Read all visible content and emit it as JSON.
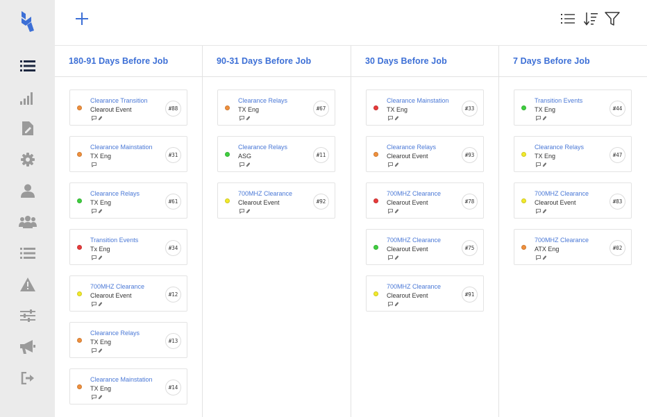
{
  "sidebar": {
    "items": [
      {
        "name": "list-icon",
        "active": true
      },
      {
        "name": "bar-chart-icon"
      },
      {
        "name": "document-edit-icon"
      },
      {
        "name": "gear-icon"
      },
      {
        "name": "user-icon"
      },
      {
        "name": "users-group-icon"
      },
      {
        "name": "list-view-icon"
      },
      {
        "name": "warning-icon"
      },
      {
        "name": "sliders-icon"
      },
      {
        "name": "megaphone-icon"
      },
      {
        "name": "sign-out-icon"
      }
    ]
  },
  "colors": {
    "accent": "#3c6fd6",
    "orange": "#f0903c",
    "red": "#e83b3b",
    "green": "#3fcf3f",
    "yellow": "#f2ea2a"
  },
  "board": {
    "columns": [
      {
        "title": "180-91 Days Before Job",
        "cards": [
          {
            "title": "Clearance Transition",
            "subtitle": "Clearout Event",
            "badge": "#88",
            "status": "orange",
            "attach": true
          },
          {
            "title": "Clearance Mainstation",
            "subtitle": "TX Eng",
            "badge": "#31",
            "status": "orange",
            "attach": false
          },
          {
            "title": "Clearance Relays",
            "subtitle": "TX Eng",
            "badge": "#61",
            "status": "green",
            "attach": true
          },
          {
            "title": "Transition Events",
            "subtitle": "Tx Eng",
            "badge": "#34",
            "status": "red",
            "attach": true
          },
          {
            "title": "700MHZ Clearance",
            "subtitle": "Clearout Event",
            "badge": "#12",
            "status": "yellow",
            "attach": true
          },
          {
            "title": "Clearance Relays",
            "subtitle": "TX Eng",
            "badge": "#13",
            "status": "orange",
            "attach": true
          },
          {
            "title": "Clearance Mainstation",
            "subtitle": "TX Eng",
            "badge": "#14",
            "status": "orange",
            "attach": true
          }
        ]
      },
      {
        "title": "90-31 Days Before Job",
        "cards": [
          {
            "title": "Clearance Relays",
            "subtitle": "TX Eng",
            "badge": "#67",
            "status": "orange",
            "attach": true
          },
          {
            "title": "Clearance Relays",
            "subtitle": "ASG",
            "badge": "#11",
            "status": "green",
            "attach": true
          },
          {
            "title": "700MHZ Clearance",
            "subtitle": "Clearout Event",
            "badge": "#92",
            "status": "yellow",
            "attach": true
          }
        ]
      },
      {
        "title": "30 Days Before Job",
        "cards": [
          {
            "title": "Clearance Mainstation",
            "subtitle": "TX Eng",
            "badge": "#33",
            "status": "red",
            "attach": true
          },
          {
            "title": "Clearance Relays",
            "subtitle": "Clearout Event",
            "badge": "#93",
            "status": "orange",
            "attach": true
          },
          {
            "title": "700MHZ Clearance",
            "subtitle": "Clearout Event",
            "badge": "#78",
            "status": "red",
            "attach": true
          },
          {
            "title": "700MHZ Clearance",
            "subtitle": "Clearout Event",
            "badge": "#75",
            "status": "green",
            "attach": true
          },
          {
            "title": "700MHZ Clearance",
            "subtitle": "Clearout Event",
            "badge": "#91",
            "status": "yellow",
            "attach": true
          }
        ]
      },
      {
        "title": "7 Days Before Job",
        "cards": [
          {
            "title": "Transition Events",
            "subtitle": "TX Eng",
            "badge": "#44",
            "status": "green",
            "attach": true
          },
          {
            "title": "Clearance Relays",
            "subtitle": "TX Eng",
            "badge": "#47",
            "status": "yellow",
            "attach": true
          },
          {
            "title": "700MHZ Clearance",
            "subtitle": "Clearout Event",
            "badge": "#83",
            "status": "yellow",
            "attach": true
          },
          {
            "title": "700MHZ Clearance",
            "subtitle": "ATX Eng",
            "badge": "#02",
            "status": "orange",
            "attach": true
          }
        ]
      }
    ]
  }
}
